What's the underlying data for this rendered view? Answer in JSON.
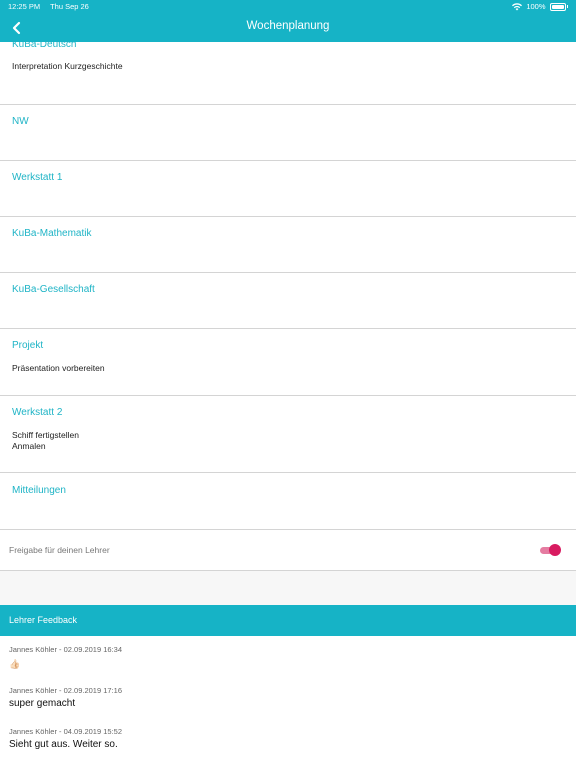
{
  "status_bar": {
    "time": "12:25 PM",
    "date": "Thu Sep 26",
    "battery": "100%"
  },
  "nav": {
    "title": "Wochenplanung",
    "back_icon": "chevron-left-icon"
  },
  "subjects": [
    {
      "name": "KuBa-Deutsch",
      "tasks": [
        "Interpretation Kurzgeschichte"
      ]
    },
    {
      "name": "NW",
      "tasks": []
    },
    {
      "name": "Werkstatt 1",
      "tasks": []
    },
    {
      "name": "KuBa-Mathematik",
      "tasks": []
    },
    {
      "name": "KuBa-Gesellschaft",
      "tasks": []
    },
    {
      "name": "Projekt",
      "tasks": [
        "Präsentation vorbereiten"
      ]
    },
    {
      "name": "Werkstatt 2",
      "tasks": [
        "Schiff fertigstellen",
        "Anmalen"
      ]
    },
    {
      "name": "Mitteilungen",
      "tasks": []
    }
  ],
  "share_toggle": {
    "label": "Freigabe für deinen Lehrer",
    "on": true,
    "color": "#d81b60"
  },
  "feedback": {
    "header": "Lehrer Feedback",
    "items": [
      {
        "author_date": "Jannes Köhler - 02.09.2019 16:34",
        "message": "",
        "icon": "thumbs-up-icon"
      },
      {
        "author_date": "Jannes Köhler - 02.09.2019 17:16",
        "message": "super gemacht"
      },
      {
        "author_date": "Jannes Köhler - 04.09.2019 15:52",
        "message": "Sieht gut aus. Weiter so."
      }
    ]
  },
  "colors": {
    "accent": "#16b3c6",
    "subject_text": "#1fb4c6",
    "divider": "#d4d4d4"
  }
}
